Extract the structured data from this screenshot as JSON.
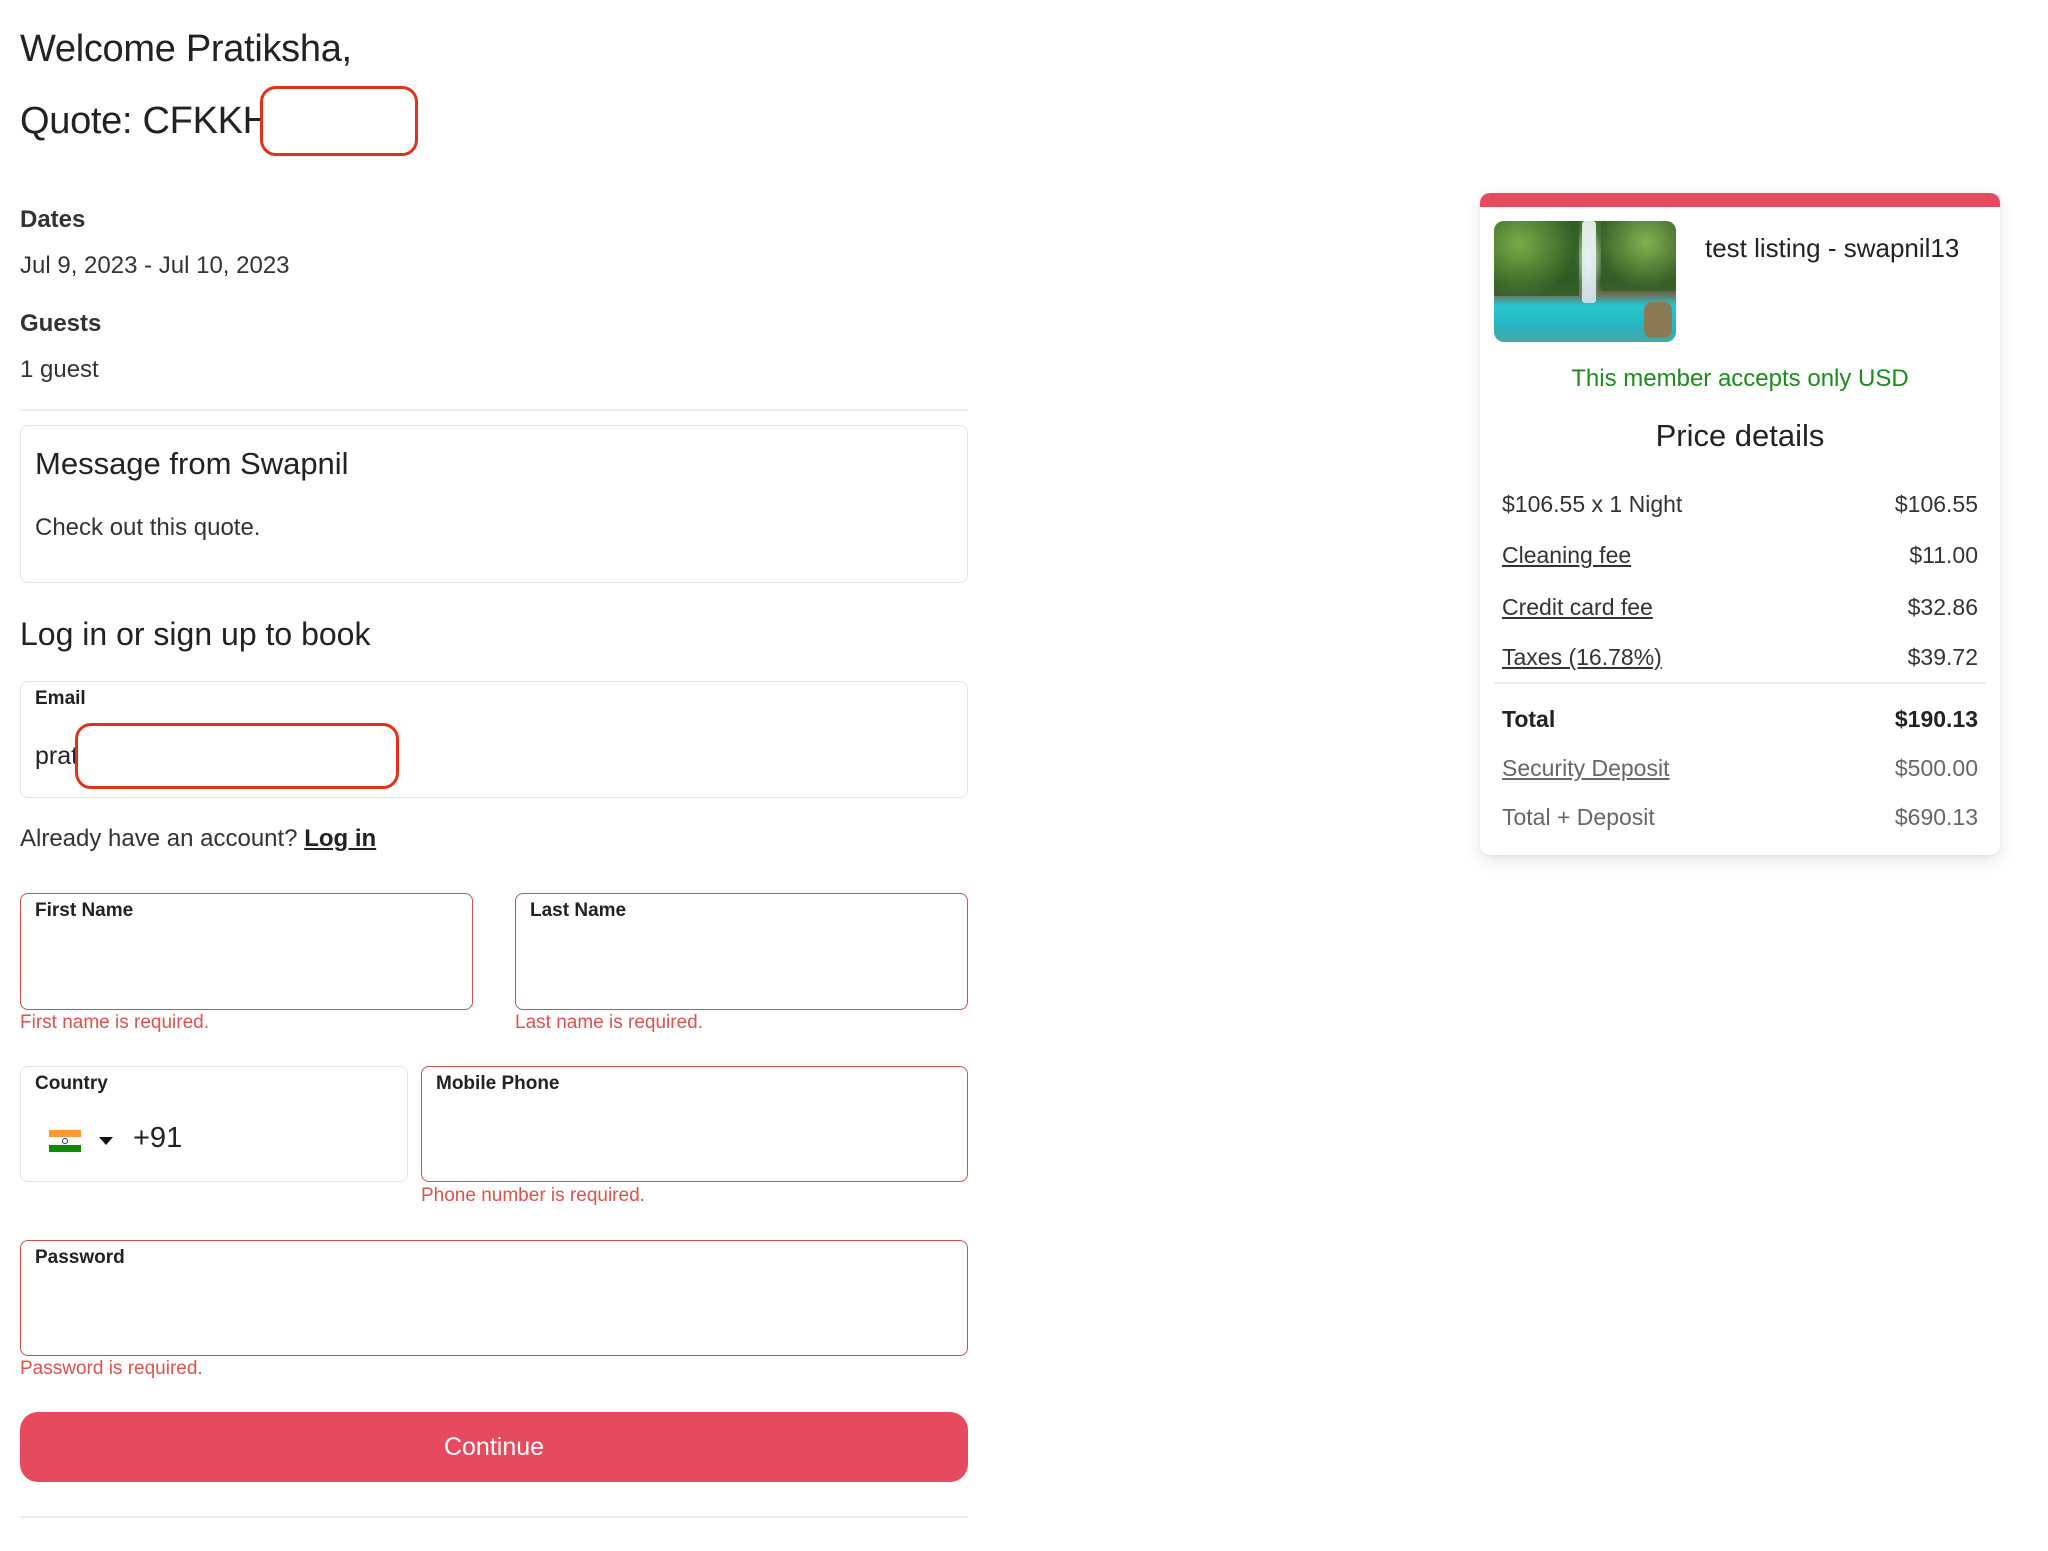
{
  "header": {
    "welcome": "Welcome Pratiksha,",
    "quote": "Quote: CFKKH"
  },
  "trip": {
    "dates_label": "Dates",
    "dates_value": "Jul 9, 2023 - Jul 10, 2023",
    "guests_label": "Guests",
    "guests_value": "1 guest"
  },
  "message": {
    "title": "Message from Swapnil",
    "body": "Check out this quote."
  },
  "login": {
    "heading": "Log in or sign up to book",
    "email_label": "Email",
    "email_value": "prat",
    "already_text": "Already have an account?",
    "login_link": "Log in"
  },
  "form": {
    "first_name": {
      "label": "First Name",
      "value": "",
      "error": "First name is required."
    },
    "last_name": {
      "label": "Last Name",
      "value": "",
      "error": "Last name is required."
    },
    "country": {
      "label": "Country",
      "flag": "india-flag-icon",
      "dial_code": "+91"
    },
    "mobile_phone": {
      "label": "Mobile Phone",
      "value": "",
      "error": "Phone number is required."
    },
    "password": {
      "label": "Password",
      "value": "",
      "error": "Password is required."
    },
    "continue_label": "Continue"
  },
  "price_card": {
    "listing_title": "test listing - swapnil13",
    "currency_note": "This member accepts only USD",
    "heading": "Price details",
    "rows": [
      {
        "label": "$106.55 x 1 Night",
        "value": "$106.55",
        "link": false
      },
      {
        "label": "Cleaning fee",
        "value": "$11.00",
        "link": true
      },
      {
        "label": "Credit card fee",
        "value": "$32.86",
        "link": true
      },
      {
        "label": "Taxes (16.78%)",
        "value": "$39.72",
        "link": true
      }
    ],
    "total": {
      "label": "Total",
      "value": "$190.13"
    },
    "security_deposit": {
      "label": "Security Deposit",
      "value": "$500.00"
    },
    "total_plus_deposit": {
      "label": "Total + Deposit",
      "value": "$690.13"
    }
  },
  "colors": {
    "accent": "#e64a5f",
    "error": "#d9534f",
    "success": "#1e8a1e"
  }
}
